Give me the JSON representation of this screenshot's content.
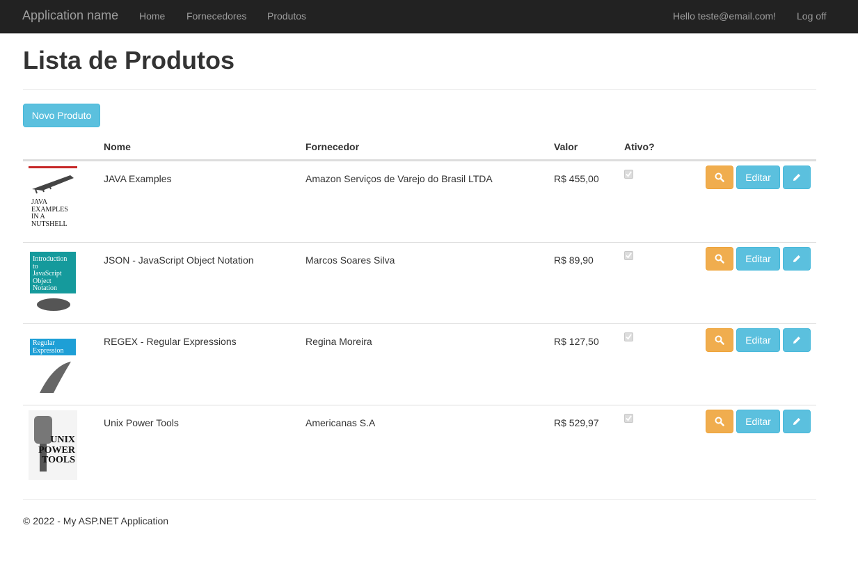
{
  "navbar": {
    "brand": "Application name",
    "links": [
      "Home",
      "Fornecedores",
      "Produtos"
    ],
    "greeting": "Hello teste@email.com!",
    "logoff": "Log off"
  },
  "page": {
    "title": "Lista de Produtos",
    "new_button": "Novo Produto"
  },
  "table": {
    "headers": {
      "nome": "Nome",
      "fornecedor": "Fornecedor",
      "valor": "Valor",
      "ativo": "Ativo?"
    },
    "rows": [
      {
        "nome": "JAVA Examples",
        "fornecedor": "Amazon Serviços de Varejo do Brasil LTDA",
        "valor": "R$ 455,00",
        "ativo": true,
        "edit_label": "Editar"
      },
      {
        "nome": "JSON - JavaScript Object Notation",
        "fornecedor": "Marcos Soares Silva",
        "valor": "R$ 89,90",
        "ativo": true,
        "edit_label": "Editar"
      },
      {
        "nome": "REGEX - Regular Expressions",
        "fornecedor": "Regina Moreira",
        "valor": "R$ 127,50",
        "ativo": true,
        "edit_label": "Editar"
      },
      {
        "nome": "Unix Power Tools",
        "fornecedor": "Americanas S.A",
        "valor": "R$ 529,97",
        "ativo": true,
        "edit_label": "Editar"
      }
    ],
    "covers": [
      {
        "lines": [
          "JAVA",
          "EXAMPLES",
          "IN A NUTSHELL"
        ],
        "color": "#c62828"
      },
      {
        "lines": [
          "Introduction to",
          "JavaScript",
          "Object",
          "Notation"
        ],
        "color": "#159a9c"
      },
      {
        "lines": [
          "Regular",
          "Expression"
        ],
        "color": "#1e9fd6"
      },
      {
        "lines": [
          "UNIX",
          "POWER",
          "TOOLS"
        ],
        "color": "#111111"
      }
    ]
  },
  "footer": {
    "text": "© 2022 - My ASP.NET Application"
  }
}
